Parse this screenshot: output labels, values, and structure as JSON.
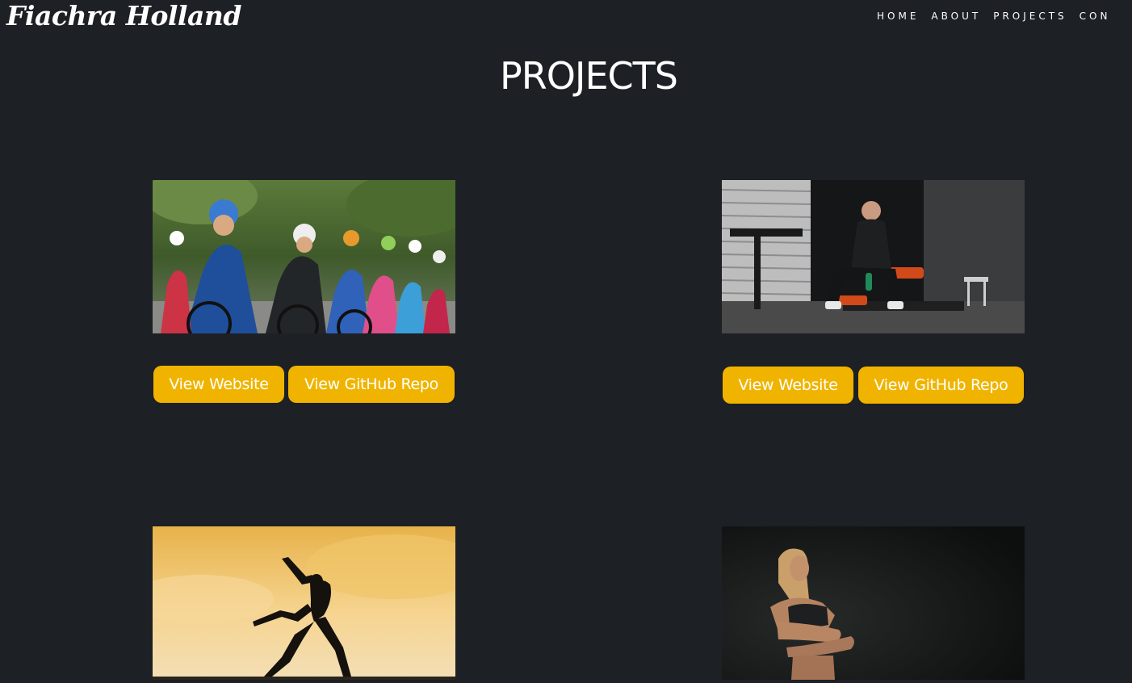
{
  "header": {
    "logo": "Fiachra Holland",
    "nav": [
      "HOME",
      "ABOUT",
      "PROJECTS",
      "CON"
    ]
  },
  "main": {
    "title": "PROJECTS",
    "projects": [
      {
        "image": "cyclists-racing-photo",
        "buttons": {
          "website": "View Website",
          "repo": "View GitHub Repo"
        }
      },
      {
        "image": "gym-athlete-photo",
        "buttons": {
          "website": "View Website",
          "repo": "View GitHub Repo"
        }
      },
      {
        "image": "dancer-silhouette-sunset-photo"
      },
      {
        "image": "fitness-woman-dark-photo"
      }
    ]
  },
  "colors": {
    "background": "#1d2024",
    "accent": "#f0b400",
    "text": "#ffffff"
  }
}
